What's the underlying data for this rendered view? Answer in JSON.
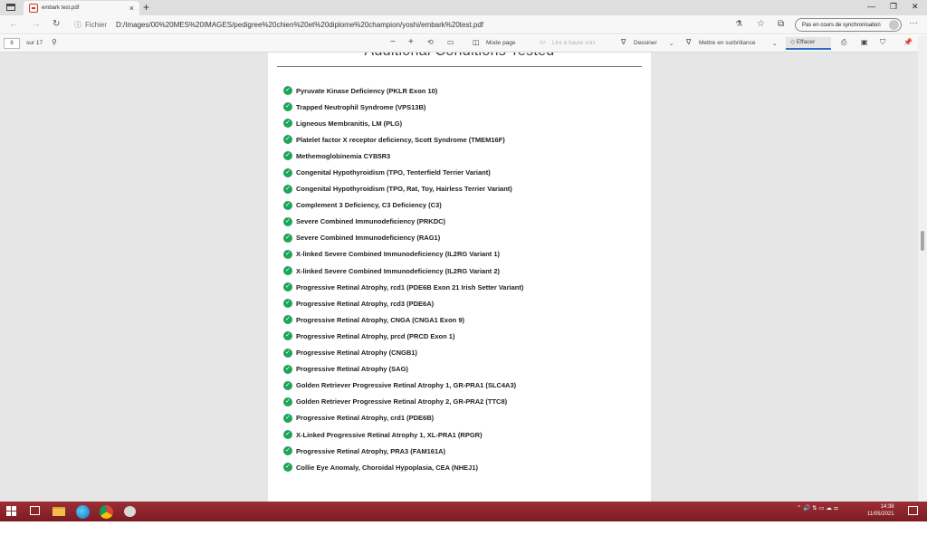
{
  "browser": {
    "tab_title": "embark test.pdf",
    "tab_close": "×",
    "new_tab": "+",
    "url_label": "Fichier",
    "url": "D:/Images/00%20MES%20IMAGES/pedigree%20chien%20et%20diplome%20champion/yoshi/embark%20test.pdf",
    "sync_label": "Pas en cours de synchronisation",
    "more": "···"
  },
  "pdf_toolbar": {
    "page_number": "8",
    "page_total": "sur 17",
    "zoom_out": "−",
    "zoom_in": "+",
    "page_mode": "Mode page",
    "read_aloud": "Lire à haute voix",
    "draw": "Dessiner",
    "highlight": "Mettre en surbrillance",
    "erase": "Effacer"
  },
  "document": {
    "heading": "Additional Conditions Tested",
    "conditions": [
      "Pyruvate Kinase Deficiency (PKLR Exon 10)",
      "Trapped Neutrophil Syndrome (VPS13B)",
      "Ligneous Membranitis, LM (PLG)",
      "Platelet factor X receptor deficiency, Scott Syndrome (TMEM16F)",
      "Methemoglobinemia CYB5R3",
      "Congenital Hypothyroidism (TPO, Tenterfield Terrier Variant)",
      "Congenital Hypothyroidism (TPO, Rat, Toy, Hairless Terrier Variant)",
      "Complement 3 Deficiency, C3 Deficiency (C3)",
      "Severe Combined Immunodeficiency (PRKDC)",
      "Severe Combined Immunodeficiency (RAG1)",
      "X-linked Severe Combined Immunodeficiency (IL2RG Variant 1)",
      "X-linked Severe Combined Immunodeficiency (IL2RG Variant 2)",
      "Progressive Retinal Atrophy, rcd1 (PDE6B Exon 21 Irish Setter Variant)",
      "Progressive Retinal Atrophy, rcd3 (PDE6A)",
      "Progressive Retinal Atrophy, CNGA (CNGA1 Exon 9)",
      "Progressive Retinal Atrophy, prcd (PRCD Exon 1)",
      "Progressive Retinal Atrophy (CNGB1)",
      "Progressive Retinal Atrophy (SAG)",
      "Golden Retriever Progressive Retinal Atrophy 1, GR-PRA1 (SLC4A3)",
      "Golden Retriever Progressive Retinal Atrophy 2, GR-PRA2 (TTC8)",
      "Progressive Retinal Atrophy, crd1 (PDE6B)",
      "X-Linked Progressive Retinal Atrophy 1, XL-PRA1 (RPGR)",
      "Progressive Retinal Atrophy, PRA3 (FAM161A)",
      "Collie Eye Anomaly, Choroidal Hypoplasia, CEA (NHEJ1)"
    ],
    "check_glyph": "✓"
  },
  "taskbar": {
    "time": "14:38",
    "date": "11/05/2021"
  },
  "colors": {
    "check_green": "#21a35a",
    "taskbar_red": "#8b252b"
  }
}
